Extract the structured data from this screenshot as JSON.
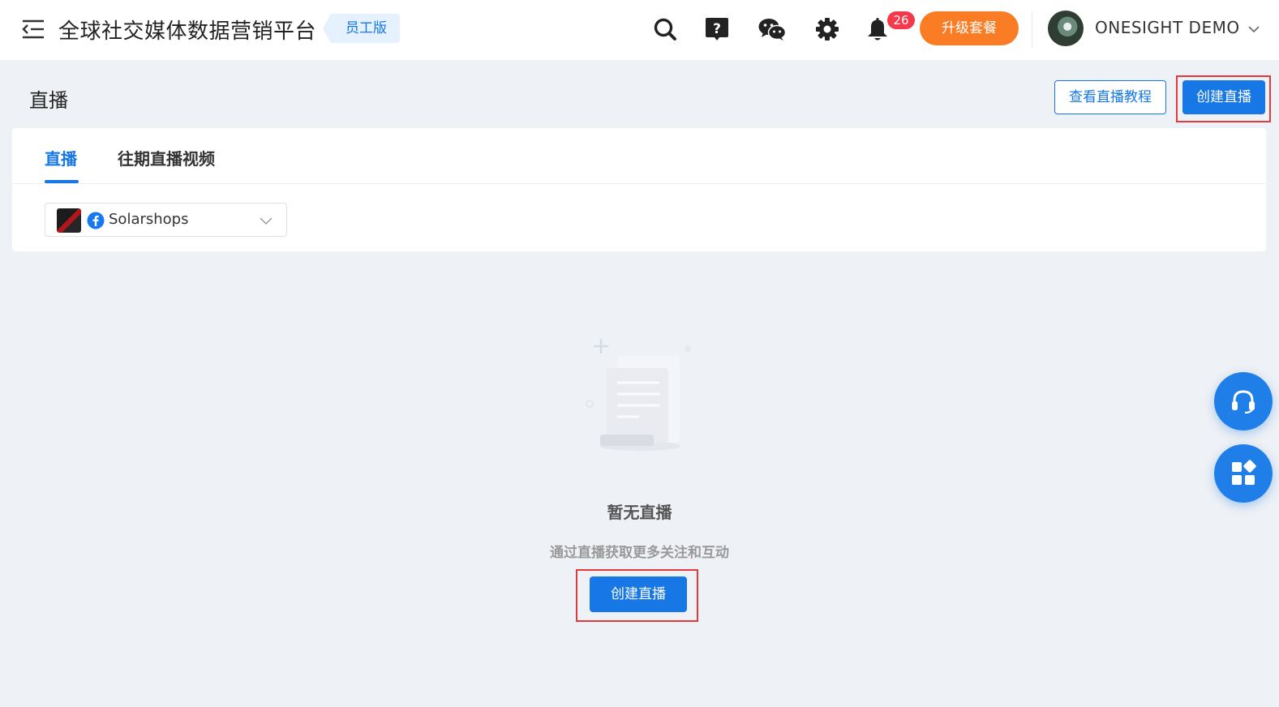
{
  "header": {
    "app_title": "全球社交媒体数据营销平台",
    "edition_badge": "员工版",
    "notification_count": "26",
    "upgrade_label": "升级套餐",
    "user_name": "ONESIGHT DEMO",
    "icons": [
      "menu-toggle-icon",
      "search-icon",
      "help-icon",
      "wechat-icon",
      "settings-icon",
      "bell-icon",
      "chevron-down-icon"
    ]
  },
  "page": {
    "title": "直播",
    "tutorial_label": "查看直播教程",
    "create_label": "创建直播"
  },
  "tabs": [
    {
      "label": "直播",
      "active": true
    },
    {
      "label": "往期直播视频",
      "active": false
    }
  ],
  "account_select": {
    "platform": "facebook",
    "selected": "Solarshops"
  },
  "empty_state": {
    "title": "暂无直播",
    "subtitle": "通过直播获取更多关注和互动",
    "button_label": "创建直播"
  },
  "floating": {
    "icons": [
      "headset-icon",
      "apps-grid-icon"
    ]
  },
  "colors": {
    "primary": "#1677e5",
    "upgrade": "#fa7d26",
    "badge": "#f5394a",
    "highlight": "#e33b3b",
    "background": "#eef1f5"
  }
}
